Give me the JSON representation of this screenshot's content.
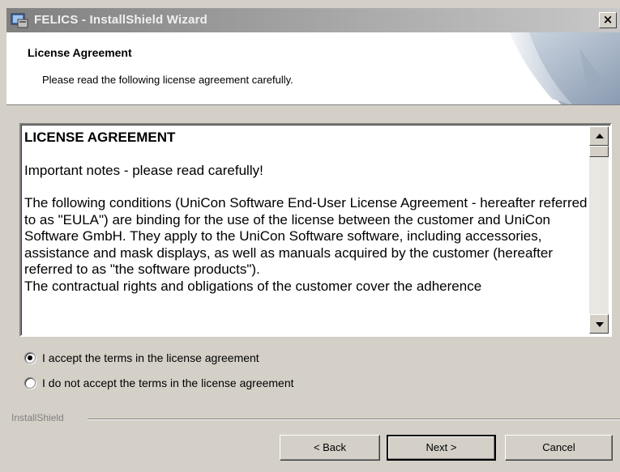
{
  "window": {
    "title": "FELICS - InstallShield Wizard",
    "close_label": "×"
  },
  "header": {
    "title": "License Agreement",
    "subtitle": "Please read the following license agreement carefully."
  },
  "license": {
    "heading": "LICENSE AGREEMENT",
    "note": "Important notes - please read carefully!",
    "body": "The following conditions (UniCon Software End-User License Agreement - hereafter referred to as \"EULA\") are binding for the use of the license between the customer and UniCon Software GmbH. They apply to the UniCon Software software, including accessories, assistance and mask displays, as well as manuals acquired by the customer (hereafter referred to as \"the software products\").",
    "cutoff": "The contractual rights and obligations of the customer cover the adherence"
  },
  "options": {
    "accept": {
      "label": "I accept the terms in the license agreement",
      "checked": true
    },
    "decline": {
      "label": "I do not accept the terms in the license agreement",
      "checked": false
    }
  },
  "footer": {
    "brand": "InstallShield"
  },
  "buttons": {
    "back": "< Back",
    "next": "Next >",
    "cancel": "Cancel"
  },
  "colors": {
    "face": "#d4d0c8",
    "titlebar": "#808080"
  }
}
